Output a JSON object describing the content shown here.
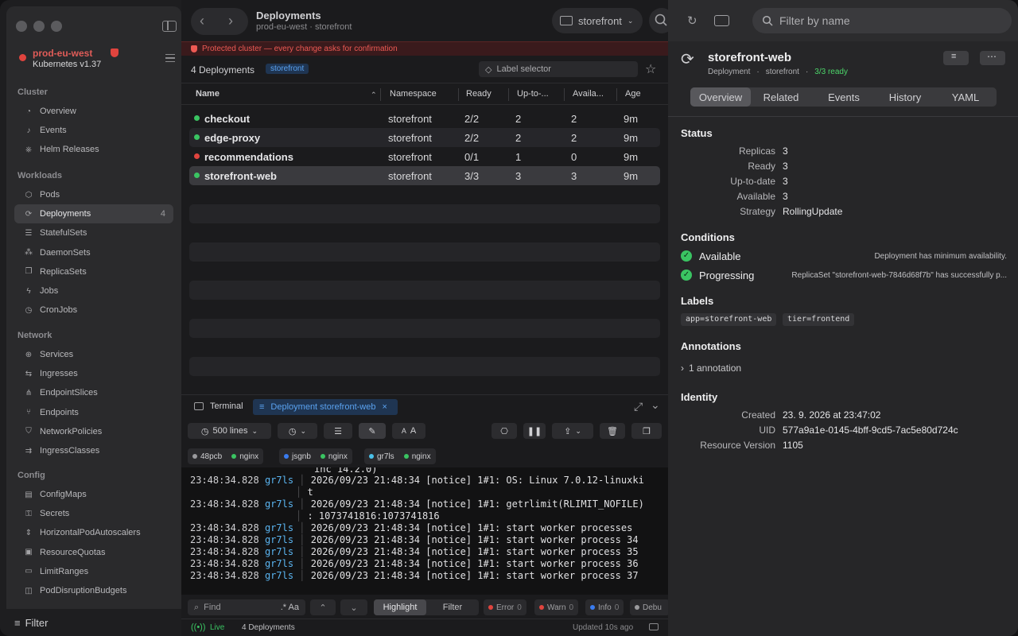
{
  "sidebar": {
    "context": {
      "name": "prod-eu-west",
      "version": "Kubernetes v1.37"
    },
    "sections": [
      {
        "title": "Cluster",
        "items": [
          {
            "label": "Overview",
            "icon": "gauge-icon"
          },
          {
            "label": "Events",
            "icon": "bell-icon"
          },
          {
            "label": "Helm Releases",
            "icon": "helm-icon"
          }
        ]
      },
      {
        "title": "Workloads",
        "items": [
          {
            "label": "Pods",
            "icon": "cube-icon"
          },
          {
            "label": "Deployments",
            "icon": "sync-icon",
            "badge": "4",
            "active": true
          },
          {
            "label": "StatefulSets",
            "icon": "stack-icon"
          },
          {
            "label": "DaemonSets",
            "icon": "grid-icon"
          },
          {
            "label": "ReplicaSets",
            "icon": "copy-icon"
          },
          {
            "label": "Jobs",
            "icon": "bolt-icon"
          },
          {
            "label": "CronJobs",
            "icon": "clock-icon"
          }
        ]
      },
      {
        "title": "Network",
        "items": [
          {
            "label": "Services",
            "icon": "globe-icon"
          },
          {
            "label": "Ingresses",
            "icon": "arrows-icon"
          },
          {
            "label": "EndpointSlices",
            "icon": "nodes-icon"
          },
          {
            "label": "Endpoints",
            "icon": "branch-icon"
          },
          {
            "label": "NetworkPolicies",
            "icon": "shield-icon"
          },
          {
            "label": "IngressClasses",
            "icon": "ingress-class-icon"
          }
        ]
      },
      {
        "title": "Config",
        "items": [
          {
            "label": "ConfigMaps",
            "icon": "doc-icon"
          },
          {
            "label": "Secrets",
            "icon": "lock-icon"
          },
          {
            "label": "HorizontalPodAutoscalers",
            "icon": "scale-icon"
          },
          {
            "label": "ResourceQuotas",
            "icon": "quota-icon"
          },
          {
            "label": "LimitRanges",
            "icon": "ruler-icon"
          },
          {
            "label": "PodDisruptionBudgets",
            "icon": "budget-icon"
          }
        ]
      }
    ],
    "filter_label": "Filter"
  },
  "header": {
    "title": "Deployments",
    "subtitle": "prod-eu-west · storefront",
    "namespace": "storefront",
    "warning": "Protected cluster — every change asks for confirmation"
  },
  "list": {
    "count_label": "4 Deployments",
    "namespace_pill": "storefront",
    "label_selector_placeholder": "Label selector",
    "columns": [
      "Name",
      "Namespace",
      "Ready",
      "Up-to-...",
      "Availa...",
      "Age"
    ],
    "rows": [
      {
        "name": "checkout",
        "namespace": "storefront",
        "ready": "2/2",
        "uptodate": "2",
        "available": "2",
        "age": "9m",
        "status": "ok"
      },
      {
        "name": "edge-proxy",
        "namespace": "storefront",
        "ready": "2/2",
        "uptodate": "2",
        "available": "2",
        "age": "9m",
        "status": "ok"
      },
      {
        "name": "recommendations",
        "namespace": "storefront",
        "ready": "0/1",
        "uptodate": "1",
        "available": "0",
        "age": "9m",
        "status": "error"
      },
      {
        "name": "storefront-web",
        "namespace": "storefront",
        "ready": "3/3",
        "uptodate": "3",
        "available": "3",
        "age": "9m",
        "status": "ok",
        "selected": true
      }
    ]
  },
  "terminal": {
    "tab_terminal": "Terminal",
    "tab_active": "Deployment storefront-web",
    "lines_label": "500 lines",
    "font_small": "A",
    "font_large": "A",
    "pods": [
      {
        "id": "48pcb",
        "container": "nginx",
        "color": "#9a9a9d"
      },
      {
        "id": "jsgnb",
        "container": "nginx",
        "color": "#3a7cf0"
      },
      {
        "id": "gr7ls",
        "container": "nginx",
        "color": "#4ac0e8"
      }
    ],
    "partial_line": "inc 14.2.0)",
    "logs": [
      {
        "ts": "23:48:34.828",
        "pod": "gr7ls",
        "msg": "2026/09/23 21:48:34 [notice] 1#1: OS: Linux 7.0.12-linuxki",
        "cont": "t"
      },
      {
        "ts": "23:48:34.828",
        "pod": "gr7ls",
        "msg": "2026/09/23 21:48:34 [notice] 1#1: getrlimit(RLIMIT_NOFILE)",
        "cont": ": 1073741816:1073741816"
      },
      {
        "ts": "23:48:34.828",
        "pod": "gr7ls",
        "msg": "2026/09/23 21:48:34 [notice] 1#1: start worker processes"
      },
      {
        "ts": "23:48:34.828",
        "pod": "gr7ls",
        "msg": "2026/09/23 21:48:34 [notice] 1#1: start worker process 34"
      },
      {
        "ts": "23:48:34.828",
        "pod": "gr7ls",
        "msg": "2026/09/23 21:48:34 [notice] 1#1: start worker process 35"
      },
      {
        "ts": "23:48:34.828",
        "pod": "gr7ls",
        "msg": "2026/09/23 21:48:34 [notice] 1#1: start worker process 36"
      },
      {
        "ts": "23:48:34.828",
        "pod": "gr7ls",
        "msg": "2026/09/23 21:48:34 [notice] 1#1: start worker process 37"
      }
    ],
    "find_placeholder": "Find",
    "find_regex": ".* Aa",
    "highlight_label": "Highlight",
    "filter_label": "Filter",
    "levels": [
      {
        "label": "Error",
        "count": "0",
        "color": "#e0443e"
      },
      {
        "label": "Warn",
        "count": "0",
        "color": "#e0443e"
      },
      {
        "label": "Info",
        "count": "0",
        "color": "#3a7cf0"
      },
      {
        "label": "Debu",
        "count": "",
        "color": "#9a9a9d"
      }
    ]
  },
  "statusbar": {
    "live": "Live",
    "count": "4 Deployments",
    "updated": "Updated 10s ago"
  },
  "detail": {
    "filter_placeholder": "Filter by name",
    "name": "storefront-web",
    "kind": "Deployment",
    "namespace": "storefront",
    "ready": "3/3 ready",
    "tabs": [
      "Overview",
      "Related",
      "Events",
      "History",
      "YAML"
    ],
    "status_title": "Status",
    "status": [
      {
        "key": "Replicas",
        "value": "3"
      },
      {
        "key": "Ready",
        "value": "3"
      },
      {
        "key": "Up-to-date",
        "value": "3"
      },
      {
        "key": "Available",
        "value": "3"
      },
      {
        "key": "Strategy",
        "value": "RollingUpdate"
      }
    ],
    "conditions_title": "Conditions",
    "conditions": [
      {
        "name": "Available",
        "message": "Deployment has minimum availability."
      },
      {
        "name": "Progressing",
        "message": "ReplicaSet \"storefront-web-7846d68f7b\" has successfully p..."
      }
    ],
    "labels_title": "Labels",
    "labels": [
      "app=storefront-web",
      "tier=frontend"
    ],
    "annotations_title": "Annotations",
    "annotations_toggle": "1 annotation",
    "identity_title": "Identity",
    "identity": [
      {
        "key": "Created",
        "value": "23. 9. 2026 at 23:47:02"
      },
      {
        "key": "UID",
        "value": "577a9a1e-0145-4bff-9cd5-7ac5e80d724c"
      },
      {
        "key": "Resource Version",
        "value": "1105"
      }
    ]
  },
  "colors": {
    "ok": "#3ac462",
    "error": "#e0443e",
    "accent": "#5aa2f0",
    "warning": "#ee5a54"
  }
}
